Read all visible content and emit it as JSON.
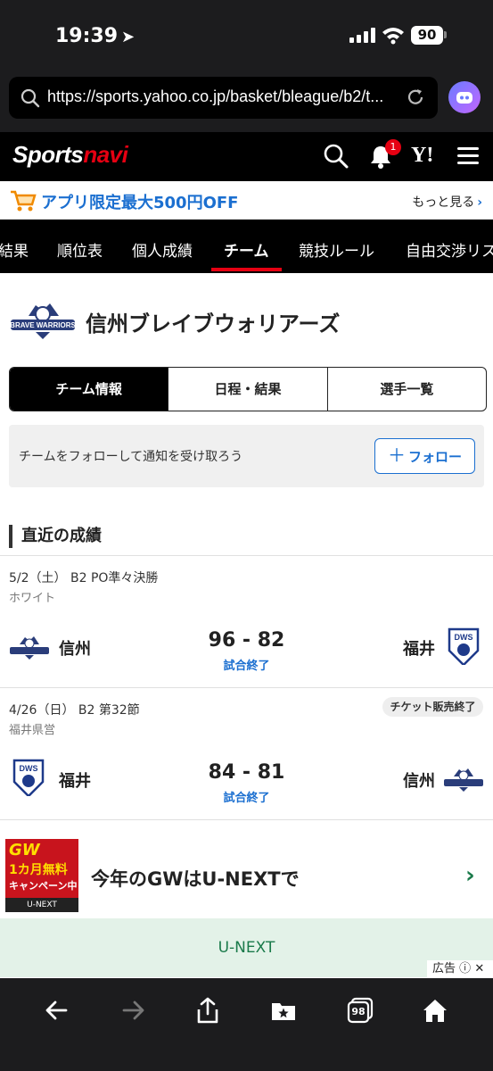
{
  "status_bar": {
    "time": "19:39",
    "battery": "90"
  },
  "browser": {
    "url": "https://sports.yahoo.co.jp/basket/bleague/b2/t..."
  },
  "header": {
    "logo_sports": "Sports",
    "logo_navi": "navi",
    "notification_count": "1",
    "yahoo_label": "Y!"
  },
  "promo": {
    "text": "アプリ限定最大500円OFF",
    "more": "もっと見る"
  },
  "nav": {
    "items": [
      "結果",
      "順位表",
      "個人成績",
      "チーム",
      "競技ルール",
      "自由交渉リスト"
    ],
    "active": "チーム"
  },
  "team": {
    "name": "信州ブレイブウォリアーズ"
  },
  "segments": [
    "チーム情報",
    "日程・結果",
    "選手一覧"
  ],
  "follow": {
    "text": "チームをフォローして通知を受け取ろう",
    "button": "フォロー"
  },
  "section_title": "直近の成績",
  "games": [
    {
      "date": "5/2（土） B2 PO準々決勝",
      "venue": "ホワイト",
      "home": "信州",
      "away": "福井",
      "score": "96 - 82",
      "status": "試合終了",
      "badge": ""
    },
    {
      "date": "4/26（日） B2 第32節",
      "venue": "福井県営",
      "home": "福井",
      "away": "信州",
      "score": "84 - 81",
      "status": "試合終了",
      "badge": "チケット販売終了"
    }
  ],
  "ad": {
    "image_gw": "GW",
    "image_free": "1カ月無料",
    "image_campaign": "キャンペーン中",
    "image_brand": "U-NEXT",
    "text": "今年のGWはU-NEXTで",
    "banner": "U-NEXT",
    "label": "広告"
  },
  "toolbar": {
    "tabs_count": "98"
  },
  "colors": {
    "accent_red": "#e60012",
    "link_blue": "#1b6fd0",
    "ad_green": "#1a7a4a"
  }
}
